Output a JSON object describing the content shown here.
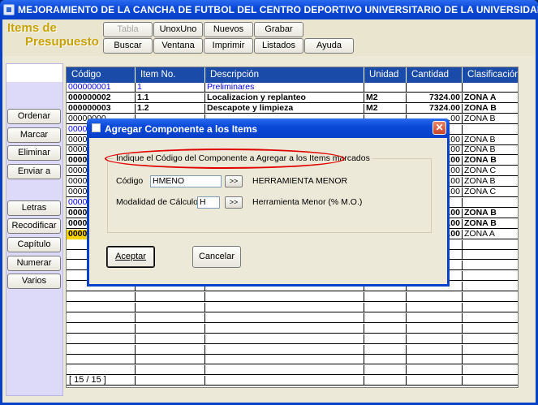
{
  "window": {
    "title": "MEJORAMIENTO DE LA CANCHA DE FUTBOL DEL CENTRO DEPORTIVO UNIVERSITARIO DE LA UNIVERSIDAD DEL CAUCA - C..."
  },
  "header": {
    "title_line1": "Items de",
    "title_line2": "Presupuesto"
  },
  "toolbar": {
    "row1": [
      "Tabla",
      "UnoxUno",
      "Nuevos",
      "Grabar"
    ],
    "row2": [
      "Buscar",
      "Ventana",
      "Imprimir",
      "Listados",
      "Ayuda"
    ]
  },
  "sidebar": {
    "group1": [
      "Ordenar",
      "Marcar",
      "Eliminar",
      "Enviar a"
    ],
    "group2": [
      "Letras",
      "Recodificar",
      "Capítulo",
      "Numerar",
      "Varios"
    ]
  },
  "grid": {
    "columns": [
      "Código",
      "Item No.",
      "Descripción",
      "Unidad",
      "Cantidad",
      "Clasificación"
    ],
    "rows": [
      {
        "codigo": "000000001",
        "item": "1",
        "desc": "Preliminares",
        "unidad": "",
        "cantidad": "",
        "clas": "",
        "style": "blue"
      },
      {
        "codigo": "000000002",
        "item": "1.1",
        "desc": "Localizacion y replanteo",
        "unidad": "M2",
        "cantidad": "7324.00",
        "clas": "ZONA A",
        "style": "bold"
      },
      {
        "codigo": "000000003",
        "item": "1.2",
        "desc": "Descapote y limpieza",
        "unidad": "M2",
        "cantidad": "7324.00",
        "clas": "ZONA B",
        "style": "bold"
      },
      {
        "codigo": "00000000",
        "item": "",
        "desc": "",
        "unidad": "",
        "cantidad": ".00",
        "clas": "ZONA B",
        "style": "normal"
      },
      {
        "codigo": "0000",
        "item": "",
        "desc": "",
        "unidad": "",
        "cantidad": "",
        "clas": "",
        "style": "blue"
      },
      {
        "codigo": "0000",
        "item": "",
        "desc": "",
        "unidad": "",
        "cantidad": ".00",
        "clas": "ZONA B",
        "style": "normal"
      },
      {
        "codigo": "0000",
        "item": "",
        "desc": "",
        "unidad": "",
        "cantidad": ".00",
        "clas": "ZONA B",
        "style": "normal"
      },
      {
        "codigo": "0000",
        "item": "",
        "desc": "",
        "unidad": "",
        "cantidad": ".00",
        "clas": "ZONA B",
        "style": "bold"
      },
      {
        "codigo": "0000",
        "item": "",
        "desc": "",
        "unidad": "",
        "cantidad": ".00",
        "clas": "ZONA C",
        "style": "normal"
      },
      {
        "codigo": "0000",
        "item": "",
        "desc": "",
        "unidad": "",
        "cantidad": ".00",
        "clas": "ZONA B",
        "style": "normal"
      },
      {
        "codigo": "0000",
        "item": "",
        "desc": "",
        "unidad": "",
        "cantidad": ".00",
        "clas": "ZONA C",
        "style": "normal"
      },
      {
        "codigo": "0000",
        "item": "",
        "desc": "",
        "unidad": "",
        "cantidad": "",
        "clas": "",
        "style": "blue"
      },
      {
        "codigo": "0000",
        "item": "",
        "desc": "",
        "unidad": "",
        "cantidad": ".00",
        "clas": "ZONA B",
        "style": "bold"
      },
      {
        "codigo": "0000",
        "item": "",
        "desc": "",
        "unidad": "",
        "cantidad": ".00",
        "clas": "ZONA B",
        "style": "bold"
      },
      {
        "codigo": "0000",
        "item": "",
        "desc": "",
        "unidad": "",
        "cantidad": ".00",
        "clas": "ZONA A",
        "style": "yellow"
      }
    ]
  },
  "status": {
    "counter": "[ 15 / 15 ]"
  },
  "dialog": {
    "title": "Agregar Componente a los Items",
    "group_label": "Indique el Código del Componente a Agregar a los Items marcados",
    "codigo_label": "Código",
    "codigo_value": "HMENO",
    "codigo_desc": "HERRAMIENTA MENOR",
    "modalidad_label": "Modalidad de Cálculo",
    "modalidad_value": "H",
    "modalidad_desc": "Herramienta Menor (% M.O.)",
    "browse_label": ">>",
    "accept_label": "Aceptar",
    "cancel_label": "Cancelar",
    "close_label": "✕"
  },
  "colors": {
    "titlebar": "#0a48d8",
    "grid_header": "#1a4ba8",
    "highlight_ellipse": "#e00000",
    "link_blue": "#0000ff",
    "row_yellow": "#ffd400"
  }
}
